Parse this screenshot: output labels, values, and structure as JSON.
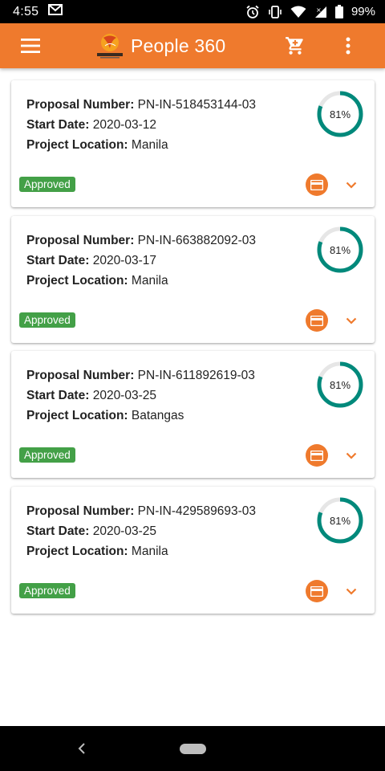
{
  "status_bar": {
    "time": "4:55",
    "battery": "99%",
    "icons": [
      "gmail-icon",
      "alarm-icon",
      "vibrate-icon",
      "wifi-icon",
      "signal-icon",
      "battery-icon"
    ]
  },
  "app_bar": {
    "title": "People 360",
    "icons": [
      "menu-icon",
      "people360-logo",
      "cart-icon",
      "more-vert-icon"
    ]
  },
  "colors": {
    "primary": "#ef7a2d",
    "progress_ring": "#00897b",
    "progress_track": "#e6e6e6",
    "status_approved": "#43a047"
  },
  "labels": {
    "proposal_number": "Proposal Number:",
    "start_date": "Start Date:",
    "project_location": "Project Location:"
  },
  "proposals": [
    {
      "proposal_number": "PN-IN-518453144-03",
      "start_date": "2020-03-12",
      "project_location": "Manila",
      "progress_label": "81%",
      "progress": 0.81,
      "status": "Approved"
    },
    {
      "proposal_number": "PN-IN-663882092-03",
      "start_date": "2020-03-17",
      "project_location": "Manila",
      "progress_label": "81%",
      "progress": 0.81,
      "status": "Approved"
    },
    {
      "proposal_number": "PN-IN-611892619-03",
      "start_date": "2020-03-25",
      "project_location": "Batangas",
      "progress_label": "81%",
      "progress": 0.81,
      "status": "Approved"
    },
    {
      "proposal_number": "PN-IN-429589693-03",
      "start_date": "2020-03-25",
      "project_location": "Manila",
      "progress_label": "81%",
      "progress": 0.81,
      "status": "Approved"
    }
  ]
}
